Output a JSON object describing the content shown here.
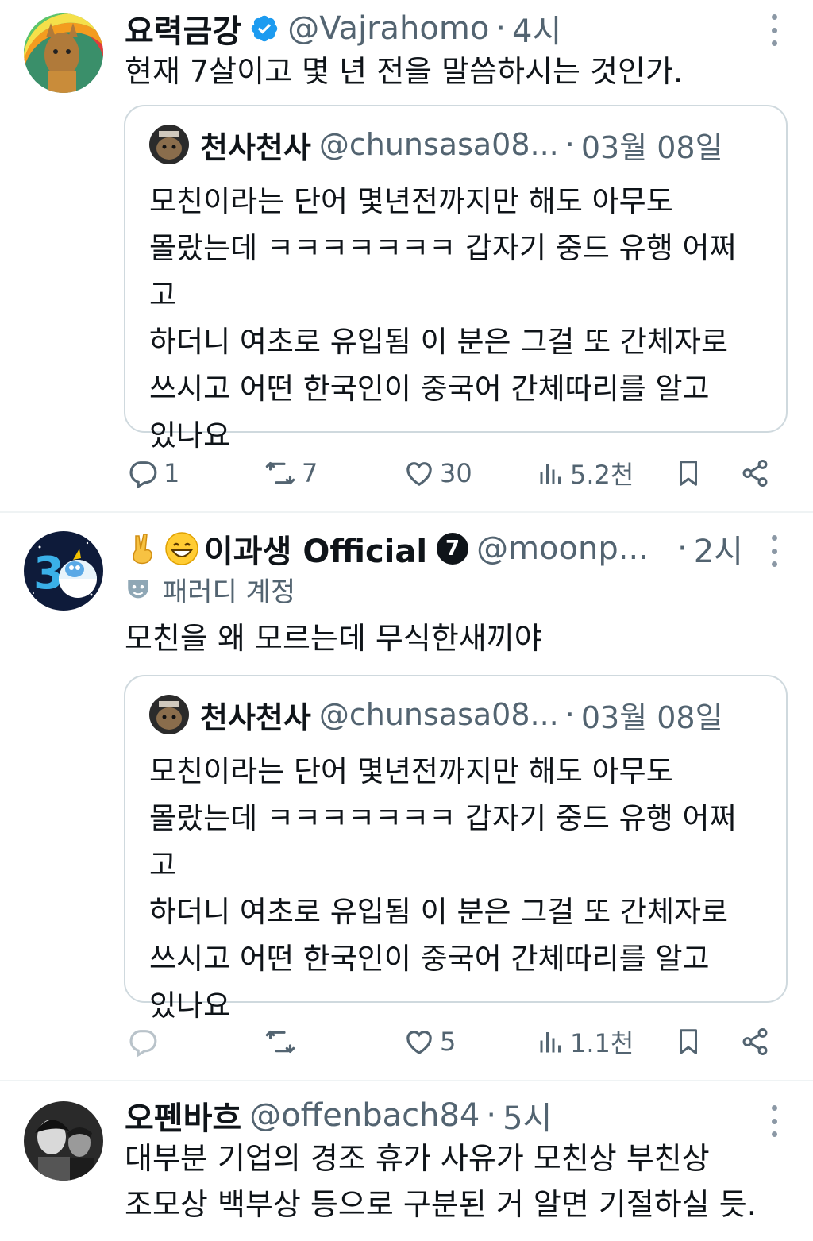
{
  "tweets": [
    {
      "name": "요력금강",
      "handle": "@Vajrahomo",
      "dot": "·",
      "time": "4시",
      "text": "현재 7살이고 몇 년 전을 말씀하시는 것인가.",
      "quote": {
        "name": "천사천사",
        "handle": "@chunsasa08...",
        "dot": "·",
        "time": "03월 08일",
        "text_lines": [
          "모친이라는 단어 몇년전까지만 해도 아무도",
          "몰랐는데 ㅋㅋㅋㅋㅋㅋㅋ 갑자기 중드 유행 어쩌고",
          "하더니 여초로 유입됨 이 분은 그걸 또 간체자로",
          "쓰시고 어떤 한국인이 중국어 간체따리를 알고",
          "있나요"
        ]
      },
      "stats": {
        "replies": "1",
        "retweets": "7",
        "likes": "30",
        "views": "5.2천"
      }
    },
    {
      "name": "이과생 Official",
      "badge": "7",
      "handle": "@moonp...",
      "dot": "·",
      "time": "2시",
      "parody_label": "패러디 계정",
      "text": "모친을 왜 모르는데 무식한새끼야",
      "quote": {
        "name": "천사천사",
        "handle": "@chunsasa08...",
        "dot": "·",
        "time": "03월 08일",
        "text_lines": [
          "모친이라는 단어 몇년전까지만 해도 아무도",
          "몰랐는데 ㅋㅋㅋㅋㅋㅋㅋ 갑자기 중드 유행 어쩌고",
          "하더니 여초로 유입됨 이 분은 그걸 또 간체자로",
          "쓰시고 어떤 한국인이 중국어 간체따리를 알고",
          "있나요"
        ]
      },
      "stats": {
        "replies": "",
        "retweets": "",
        "likes": "5",
        "views": "1.1천"
      }
    },
    {
      "name": "오펜바흐",
      "handle": "@offenbach84",
      "dot": "·",
      "time": "5시",
      "text_lines": [
        "대부분 기업의 경조 휴가 사유가 모친상 부친상",
        "조모상 백부상 등으로 구분된 거 알면 기절하실 듯."
      ]
    }
  ],
  "colors": {
    "text": "#0f1419",
    "muted": "#536471",
    "verified": "#1d9bf0",
    "border": "#cfd9de"
  },
  "icons": [
    "verified-icon",
    "more-icon",
    "reply-icon",
    "retweet-icon",
    "like-icon",
    "views-icon",
    "bookmark-icon",
    "share-icon",
    "parody-mask-icon",
    "victory-hand-icon",
    "grinning-face-icon"
  ]
}
